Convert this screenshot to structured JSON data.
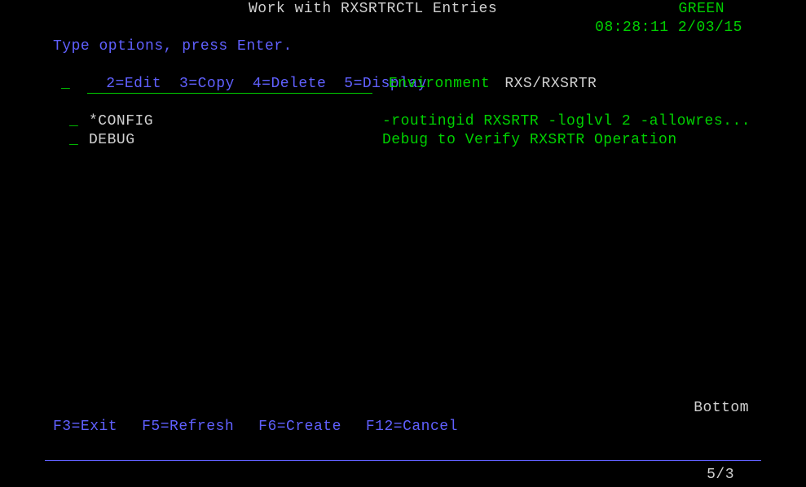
{
  "header": {
    "title": "Work with RXSRTRCTL Entries",
    "status": "GREEN",
    "time": "08:28:11",
    "date": "2/03/15"
  },
  "instructions": {
    "line1": "Type options, press Enter.",
    "options": {
      "o2": "2=Edit",
      "o3": "3=Copy",
      "o4": "4=Delete",
      "o5": "5=Display"
    }
  },
  "filter": {
    "opt_placeholder": "_",
    "env_label": "Environment",
    "env_value": "RXS/RXSRTR"
  },
  "entries": [
    {
      "opt": "_",
      "name": "*CONFIG",
      "desc": "-routingid RXSRTR -loglvl 2 -allowres..."
    },
    {
      "opt": "_",
      "name": "DEBUG",
      "desc": "Debug to Verify RXSRTR Operation"
    }
  ],
  "footer": {
    "bottom_indicator": "Bottom",
    "fkeys": {
      "f3": "F3=Exit",
      "f5": "F5=Refresh",
      "f6": "F6=Create",
      "f12": "F12=Cancel"
    },
    "cursor": "5/3"
  }
}
